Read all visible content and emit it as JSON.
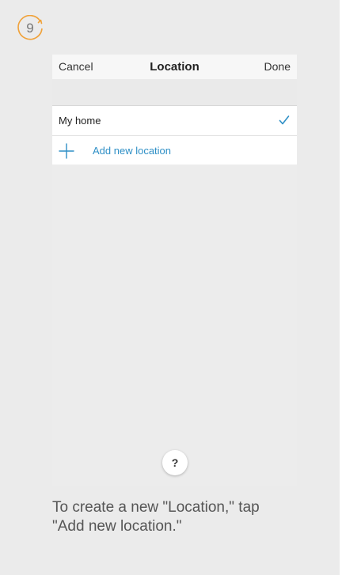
{
  "step": {
    "number": "9",
    "accent_color": "#f0a23a"
  },
  "nav": {
    "cancel_label": "Cancel",
    "title": "Location",
    "done_label": "Done"
  },
  "locations": {
    "items": [
      {
        "label": "My home",
        "selected": true,
        "icon": "checkmark-icon"
      }
    ],
    "add_label": "Add new location",
    "add_icon": "plus-icon",
    "accent_color": "#2e8fc6"
  },
  "help": {
    "label": "?"
  },
  "caption": {
    "text": "To create a new \"Location,\" tap \"Add new location.\""
  }
}
